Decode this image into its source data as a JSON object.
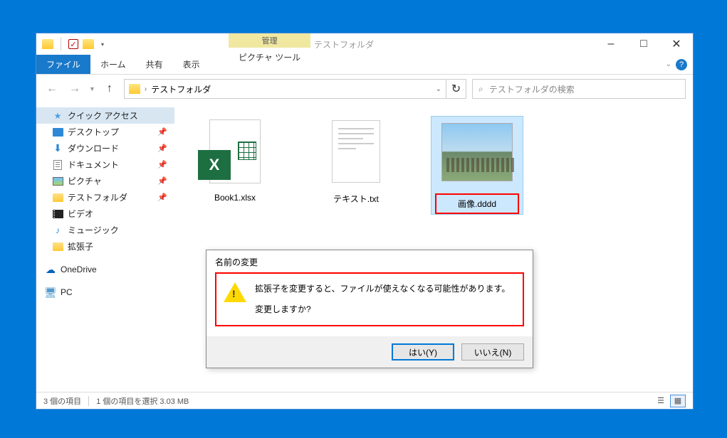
{
  "window": {
    "title": "テストフォルダ",
    "context_tab_header": "管理",
    "context_tab": "ピクチャ ツール"
  },
  "tabs": {
    "file": "ファイル",
    "home": "ホーム",
    "share": "共有",
    "view": "表示"
  },
  "address": {
    "path": "テストフォルダ"
  },
  "search": {
    "placeholder": "テストフォルダの検索"
  },
  "sidebar": {
    "quick_access": "クイック アクセス",
    "items": [
      {
        "label": "デスクトップ"
      },
      {
        "label": "ダウンロード"
      },
      {
        "label": "ドキュメント"
      },
      {
        "label": "ピクチャ"
      },
      {
        "label": "テストフォルダ"
      },
      {
        "label": "ビデオ"
      },
      {
        "label": "ミュージック"
      },
      {
        "label": "拡張子"
      }
    ],
    "onedrive": "OneDrive",
    "pc": "PC"
  },
  "files": [
    {
      "name": "Book1.xlsx"
    },
    {
      "name": "テキスト.txt"
    },
    {
      "name": "画像.dddd"
    }
  ],
  "status": {
    "count": "3 個の項目",
    "selection": "1 個の項目を選択 3.03 MB"
  },
  "dialog": {
    "title": "名前の変更",
    "line1": "拡張子を変更すると、ファイルが使えなくなる可能性があります。",
    "line2": "変更しますか?",
    "yes": "はい(Y)",
    "no": "いいえ(N)"
  }
}
